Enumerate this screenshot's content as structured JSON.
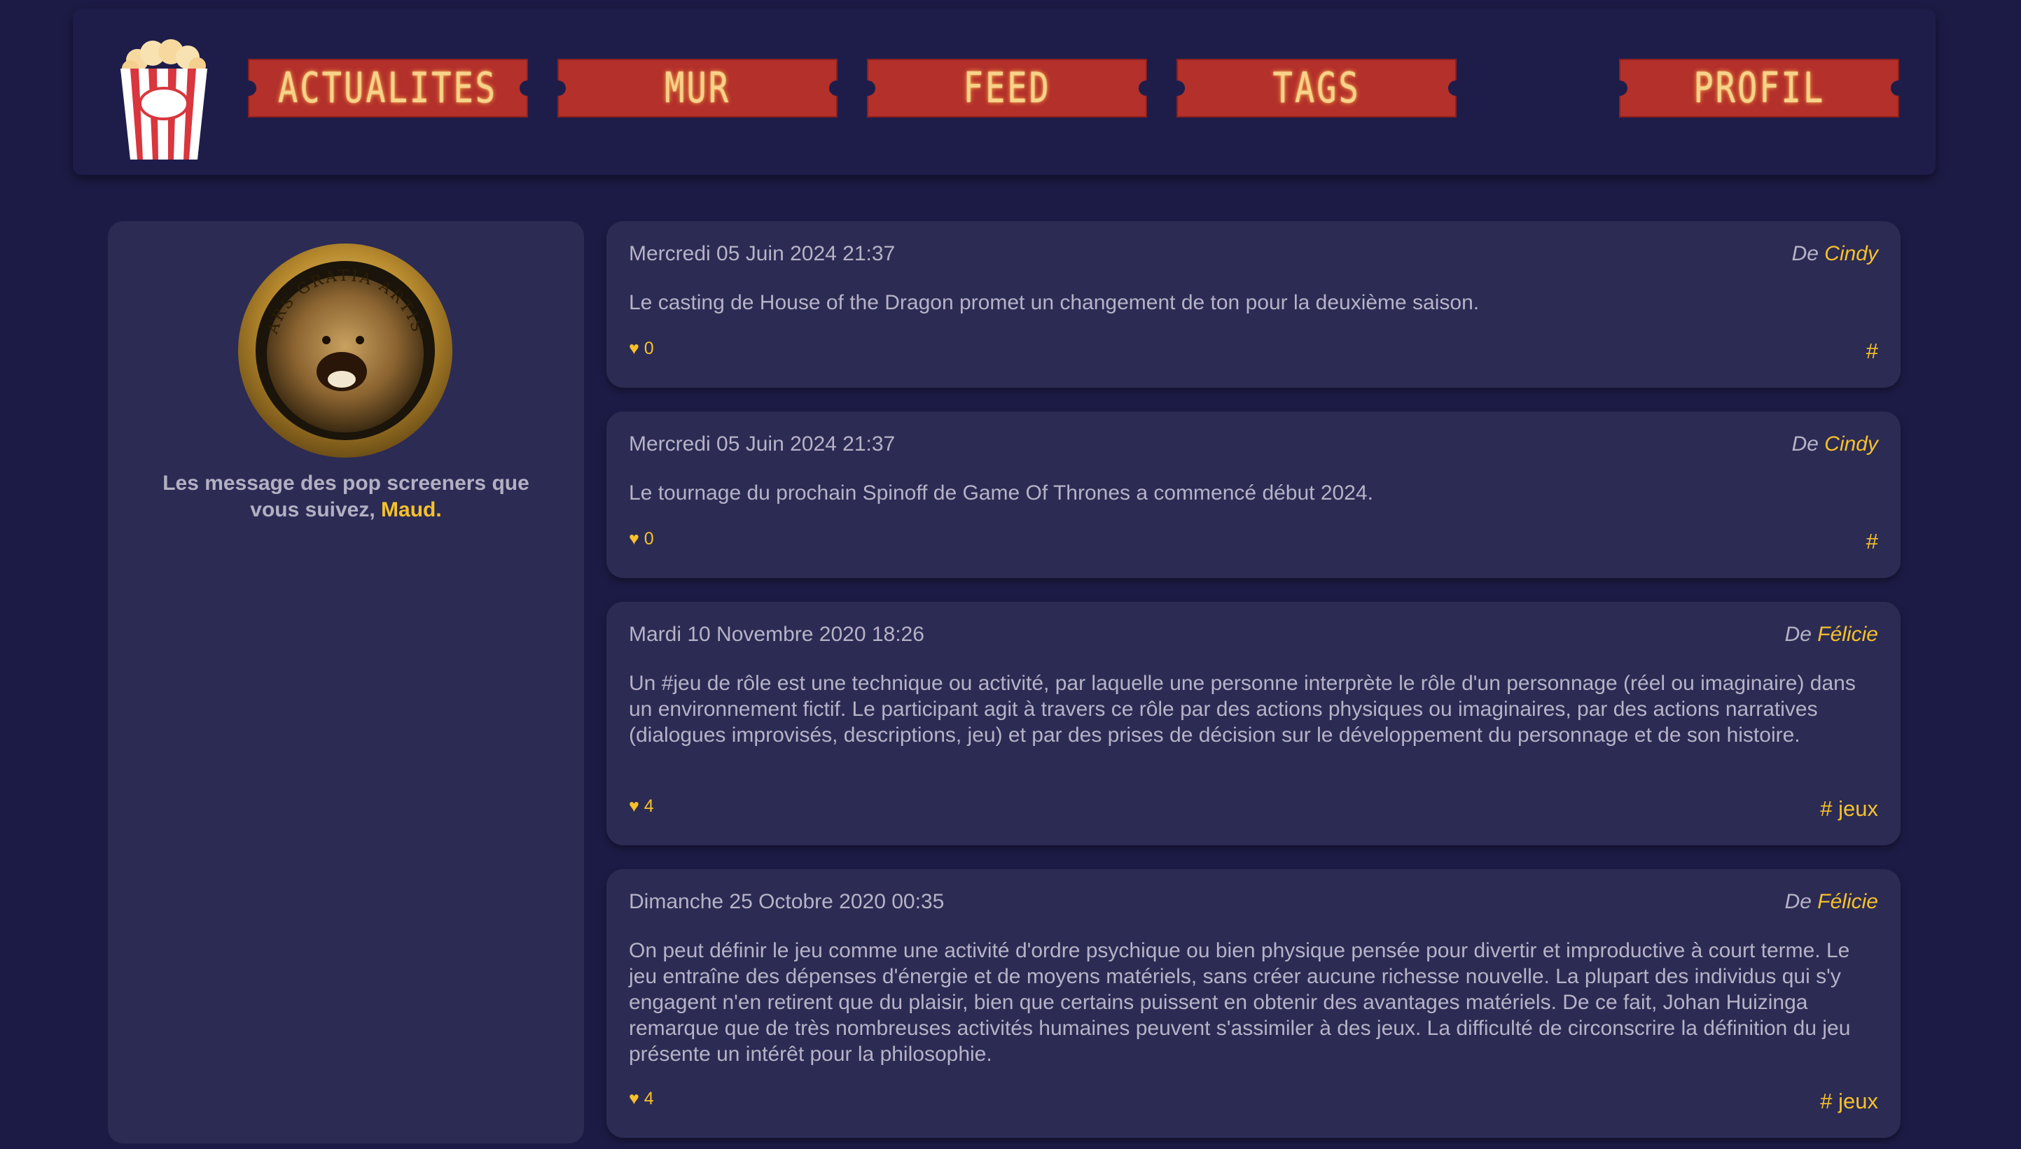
{
  "nav": {
    "items": [
      {
        "label": "ACTUALITES"
      },
      {
        "label": "MUR"
      },
      {
        "label": "FEED"
      },
      {
        "label": "TAGS"
      },
      {
        "label": "PROFIL"
      }
    ]
  },
  "icons": {
    "logo": "popcorn-icon",
    "avatar": "lion-emblem-avatar",
    "avatar_text": "ARS GRATIA ARTIS"
  },
  "colors": {
    "background": "#1c1b45",
    "panel": "#2c2b54",
    "accent": "#f6c12a",
    "ticket": "#b3302b"
  },
  "sidebar": {
    "intro": "Les message des pop screeners que vous suivez,",
    "user": "Maud."
  },
  "posts": [
    {
      "date": "Mercredi 05 Juin 2024 21:37",
      "by": "De",
      "author": "Cindy",
      "body": "Le casting de House of the Dragon promet un changement de ton pour la deuxième saison.",
      "likes": "♥ 0",
      "tag": "#"
    },
    {
      "date": "Mercredi 05 Juin 2024 21:37",
      "by": "De",
      "author": "Cindy",
      "body": "Le tournage du prochain Spinoff de Game Of Thrones a commencé début 2024.",
      "likes": "♥ 0",
      "tag": "#"
    },
    {
      "date": "Mardi 10 Novembre 2020 18:26",
      "by": "De",
      "author": "Félicie",
      "body": "Un #jeu de rôle est une technique ou activité, par laquelle une personne interprète le rôle d'un personnage (réel ou imaginaire) dans un environnement fictif. Le participant agit à travers ce rôle par des actions physiques ou imaginaires, par des actions narratives (dialogues improvisés, descriptions, jeu) et par des prises de décision sur le développement du personnage et de son histoire.",
      "likes": "♥ 4",
      "tag": "# jeux"
    },
    {
      "date": "Dimanche 25 Octobre 2020 00:35",
      "by": "De",
      "author": "Félicie",
      "body": "On peut définir le jeu comme une activité d'ordre psychique ou bien physique pensée pour divertir et improductive à court terme. Le jeu entraîne des dépenses d'énergie et de moyens matériels, sans créer aucune richesse nouvelle. La plupart des individus qui s'y engagent n'en retirent que du plaisir, bien que certains puissent en obtenir des avantages matériels. De ce fait, Johan Huizinga remarque que de très nombreuses activités humaines peuvent s'assimiler à des jeux. La difficulté de circonscrire la définition du jeu présente un intérêt pour la philosophie.",
      "likes": "♥ 4",
      "tag": "# jeux"
    }
  ]
}
